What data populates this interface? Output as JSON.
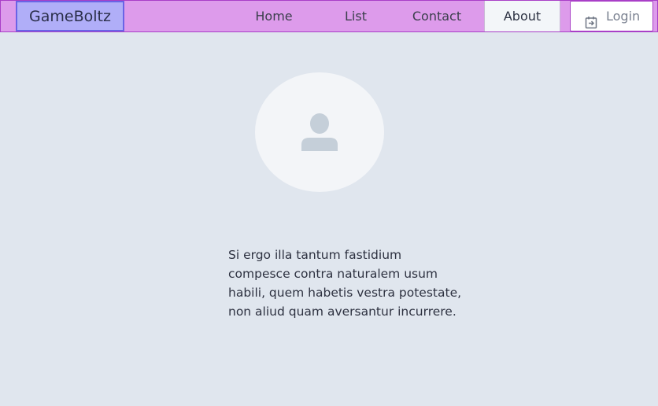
{
  "navbar": {
    "brand": "GameBoltz",
    "links": [
      {
        "label": "Home"
      },
      {
        "label": "List"
      },
      {
        "label": "Contact"
      },
      {
        "label": "About",
        "active": true
      }
    ],
    "login": {
      "label": "Login",
      "icon": "login-icon"
    }
  },
  "profile": {
    "avatar_icon": "user-icon",
    "text": "Si ergo illa tantum fastidium compesce contra naturalem usum habili, quem habetis vestra potestate, non aliud quam aversantur incurrere."
  },
  "colors": {
    "navbar_bg": "#dd9beb",
    "navbar_border": "#a93fc7",
    "brand_bg": "#b0aef8",
    "brand_border": "#6a63e6",
    "page_bg": "#e0e6ee",
    "active_tab_bg": "#f3f6f9"
  }
}
